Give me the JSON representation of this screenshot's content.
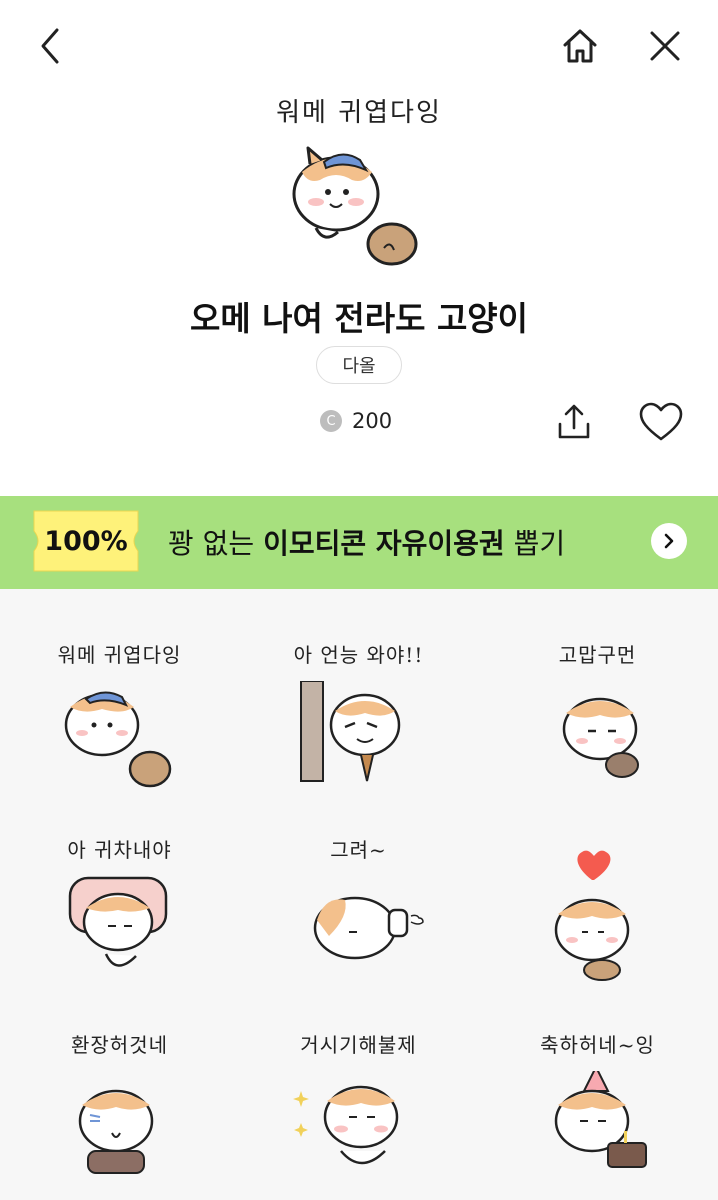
{
  "header": {
    "back_icon": "chevron-left-icon",
    "home_icon": "home-icon",
    "close_icon": "close-icon"
  },
  "hero": {
    "caption": "워메 귀엽다잉",
    "title": "오메 나여 전라도 고양이",
    "author": "다올",
    "price_icon": "coin-icon",
    "price_coin_letter": "C",
    "price": "200",
    "share_icon": "share-icon",
    "like_icon": "heart-icon"
  },
  "banner": {
    "ticket_label": "100%",
    "text_prefix": "꽝 없는 ",
    "text_bold": "이모티콘 자유이용권",
    "text_suffix": " 뽑기",
    "arrow_icon": "chevron-right-icon",
    "colors": {
      "background": "#a7e07e",
      "ticket": "#fef27a"
    }
  },
  "stickers": [
    {
      "label": "워메 귀엽다잉",
      "art": "cat-with-hat-and-bag"
    },
    {
      "label": "아 언능 와야!!",
      "art": "cat-at-door"
    },
    {
      "label": "고맙구먼",
      "art": "cat-bowing"
    },
    {
      "label": "아 귀차내야",
      "art": "cat-in-bed"
    },
    {
      "label": "그려~",
      "art": "cat-lying-down"
    },
    {
      "label": "",
      "art": "cat-with-heart"
    },
    {
      "label": "환장허것네",
      "art": "cat-worried"
    },
    {
      "label": "거시기해불제",
      "art": "cat-sparkles"
    },
    {
      "label": "축하허네~잉",
      "art": "cat-with-cake"
    }
  ]
}
